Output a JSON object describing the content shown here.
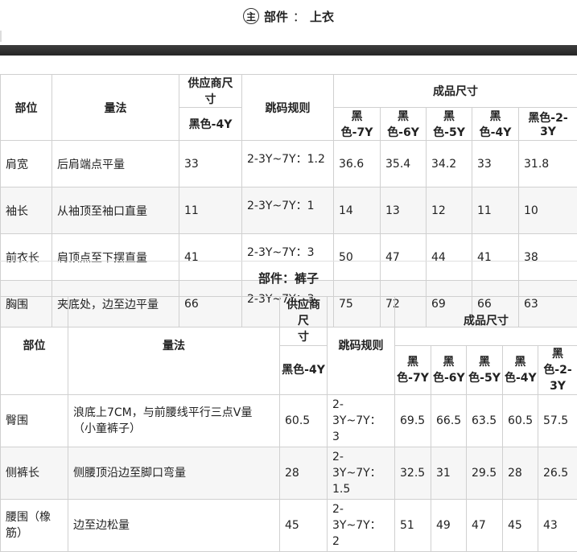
{
  "header": {
    "badge": "主",
    "label": "部件",
    "sep": "：",
    "part": "上衣"
  },
  "top_table": {
    "col_part": "部位",
    "col_method": "量法",
    "col_supplier": "供应商尺寸",
    "col_supplier_size": "黑色-4Y",
    "col_rule": "跳码规则",
    "col_finished": "成品尺寸",
    "sizes": [
      "黑色-7Y",
      "黑色-6Y",
      "黑色-5Y",
      "黑色-4Y",
      "黑色-2-3Y"
    ],
    "rows": [
      {
        "part": "肩宽",
        "method": "后肩端点平量",
        "supplier": "33",
        "rule": "2-3Y~7Y：1.2",
        "values": [
          "36.6",
          "35.4",
          "34.2",
          "33",
          "31.8"
        ]
      },
      {
        "part": "袖长",
        "method": "从袖顶至袖口直量",
        "supplier": "11",
        "rule": "2-3Y~7Y：1",
        "values": [
          "14",
          "13",
          "12",
          "11",
          "10"
        ]
      },
      {
        "part": "前衣长",
        "method": "肩顶点至下摆直量",
        "supplier": "41",
        "rule": "2-3Y~7Y：3",
        "values": [
          "50",
          "47",
          "44",
          "41",
          "38"
        ]
      },
      {
        "part": "胸围",
        "method": "夹底处，边至边平量",
        "supplier": "66",
        "rule": "2-3Y~7Y：3",
        "values": [
          "75",
          "72",
          "69",
          "66",
          "63"
        ]
      }
    ]
  },
  "mid_header": {
    "label": "部件",
    "sep": "：",
    "part": "裤子"
  },
  "bottom_table": {
    "col_part": "部位",
    "col_method": "量法",
    "col_supplier_a": "供应商尺",
    "col_supplier_b": "寸",
    "col_supplier_size": "黑色-4Y",
    "col_rule": "跳码规则",
    "col_finished": "成品尺寸",
    "sizes": [
      {
        "a": "黑",
        "b": "色-7Y"
      },
      {
        "a": "黑",
        "b": "色-6Y"
      },
      {
        "a": "黑",
        "b": "色-5Y"
      },
      {
        "a": "黑",
        "b": "色-4Y"
      },
      {
        "a": "黑色-2-",
        "b": "3Y"
      }
    ],
    "rows": [
      {
        "part_a": "臀围",
        "part_b": "",
        "method_a": "浪底上7CM，与前腰线平行三点V量",
        "method_b": "（小童裤子）",
        "supplier": "60.5",
        "rule_a": "2-3Y~7Y：",
        "rule_b": "3",
        "values": [
          "69.5",
          "66.5",
          "63.5",
          "60.5",
          "57.5"
        ]
      },
      {
        "part_a": "侧裤长",
        "part_b": "",
        "method_a": "侧腰顶沿边至脚口弯量",
        "method_b": "",
        "supplier": "28",
        "rule_a": "2-3Y~7Y：",
        "rule_b": "1.5",
        "values": [
          "32.5",
          "31",
          "29.5",
          "28",
          "26.5"
        ]
      },
      {
        "part_a": "腰围（橡",
        "part_b": "筋）",
        "method_a": "边至边松量",
        "method_b": "",
        "supplier": "45",
        "rule_a": "2-3Y~7Y：",
        "rule_b": "2",
        "values": [
          "51",
          "49",
          "47",
          "45",
          "43"
        ]
      }
    ]
  }
}
